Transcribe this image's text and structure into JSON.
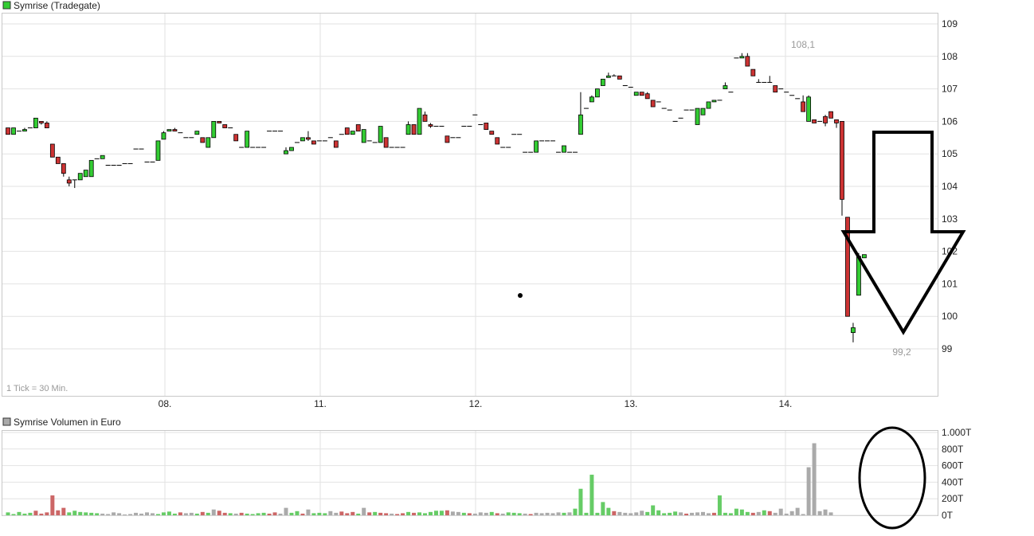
{
  "chart_data": [
    {
      "type": "candlestick",
      "title": "Symrise (Tradegate)",
      "note": "1 Tick = 30 Min.",
      "ylim": [
        98,
        109.5
      ],
      "yticks": [
        99,
        100,
        101,
        102,
        103,
        104,
        105,
        106,
        107,
        108,
        109
      ],
      "xticks": [
        "08.",
        "11.",
        "12.",
        "13.",
        "14."
      ],
      "annotations": {
        "high_label": "108,1",
        "low_label": "99,2"
      },
      "colors": {
        "up": "#33cc33",
        "down": "#cc3333",
        "neutral": "#999999"
      },
      "candles": [
        [
          105.8,
          105.6,
          105.8,
          105.6
        ],
        [
          105.6,
          105.8,
          105.8,
          105.6
        ],
        [
          105.7,
          105.7,
          105.7,
          105.7
        ],
        [
          105.7,
          105.75,
          105.8,
          105.7
        ],
        [
          105.8,
          105.8,
          105.8,
          105.8
        ],
        [
          105.8,
          106.1,
          106.1,
          105.8
        ],
        [
          106.0,
          105.95,
          106.0,
          105.9
        ],
        [
          105.95,
          105.8,
          106.0,
          105.8
        ],
        [
          105.3,
          104.9,
          105.3,
          104.9
        ],
        [
          104.9,
          104.7,
          104.9,
          104.7
        ],
        [
          104.7,
          104.4,
          104.7,
          104.3
        ],
        [
          104.2,
          104.1,
          104.3,
          104.0
        ],
        [
          104.2,
          104.2,
          104.2,
          103.95
        ],
        [
          104.2,
          104.4,
          104.4,
          104.2
        ],
        [
          104.3,
          104.5,
          104.5,
          104.3
        ],
        [
          104.3,
          104.8,
          104.8,
          104.3
        ],
        [
          104.85,
          104.85,
          104.85,
          104.85
        ],
        [
          104.85,
          104.95,
          104.95,
          104.85
        ],
        [
          104.65,
          104.65,
          104.65,
          104.65
        ],
        [
          104.65,
          104.65,
          104.65,
          104.65
        ],
        [
          104.65,
          104.65,
          104.65,
          104.65
        ],
        [
          104.7,
          104.7,
          104.7,
          104.7
        ],
        [
          104.7,
          104.7,
          104.7,
          104.7
        ],
        [
          105.15,
          105.15,
          105.15,
          105.15
        ],
        [
          105.15,
          105.15,
          105.15,
          105.15
        ],
        [
          104.75,
          104.75,
          104.75,
          104.75
        ],
        [
          104.75,
          104.75,
          104.75,
          104.75
        ],
        [
          104.8,
          105.4,
          105.4,
          104.8
        ],
        [
          105.45,
          105.65,
          105.7,
          105.45
        ],
        [
          105.7,
          105.75,
          105.75,
          105.7
        ],
        [
          105.75,
          105.7,
          105.8,
          105.7
        ],
        [
          105.65,
          105.65,
          105.65,
          105.65
        ],
        [
          105.5,
          105.5,
          105.5,
          105.5
        ],
        [
          105.5,
          105.5,
          105.5,
          105.5
        ],
        [
          105.6,
          105.7,
          105.7,
          105.6
        ],
        [
          105.5,
          105.35,
          105.5,
          105.35
        ],
        [
          105.2,
          105.5,
          105.5,
          105.2
        ],
        [
          105.5,
          106.0,
          106.0,
          105.5
        ],
        [
          106.0,
          105.95,
          106.0,
          105.95
        ],
        [
          105.9,
          105.8,
          105.9,
          105.8
        ],
        [
          105.8,
          105.8,
          105.8,
          105.8
        ],
        [
          105.6,
          105.4,
          105.6,
          105.4
        ],
        [
          105.2,
          105.2,
          105.2,
          105.2
        ],
        [
          105.2,
          105.7,
          105.7,
          105.2
        ],
        [
          105.2,
          105.2,
          105.2,
          105.2
        ],
        [
          105.2,
          105.2,
          105.2,
          105.2
        ],
        [
          105.2,
          105.2,
          105.2,
          105.2
        ],
        [
          105.7,
          105.7,
          105.7,
          105.7
        ],
        [
          105.7,
          105.7,
          105.7,
          105.7
        ],
        [
          105.7,
          105.7,
          105.7,
          105.7
        ],
        [
          105.0,
          105.1,
          105.2,
          105.0
        ],
        [
          105.1,
          105.2,
          105.2,
          105.1
        ],
        [
          105.35,
          105.35,
          105.35,
          105.35
        ],
        [
          105.4,
          105.5,
          105.5,
          105.4
        ],
        [
          105.5,
          105.45,
          105.7,
          105.4
        ],
        [
          105.4,
          105.3,
          105.4,
          105.3
        ],
        [
          105.4,
          105.4,
          105.4,
          105.4
        ],
        [
          105.4,
          105.4,
          105.4,
          105.4
        ],
        [
          105.5,
          105.5,
          105.5,
          105.5
        ],
        [
          105.4,
          105.2,
          105.4,
          105.2
        ],
        [
          105.6,
          105.6,
          105.6,
          105.6
        ],
        [
          105.8,
          105.6,
          105.8,
          105.6
        ],
        [
          105.6,
          105.7,
          105.7,
          105.6
        ],
        [
          105.9,
          105.7,
          105.9,
          105.7
        ],
        [
          105.35,
          105.75,
          105.75,
          105.35
        ],
        [
          105.4,
          105.4,
          105.4,
          105.4
        ],
        [
          105.35,
          105.35,
          105.35,
          105.35
        ],
        [
          105.35,
          105.85,
          105.85,
          105.35
        ],
        [
          105.5,
          105.2,
          105.5,
          105.2
        ],
        [
          105.2,
          105.2,
          105.2,
          105.2
        ],
        [
          105.2,
          105.2,
          105.2,
          105.2
        ],
        [
          105.2,
          105.2,
          105.2,
          105.2
        ],
        [
          105.6,
          105.9,
          106.0,
          105.6
        ],
        [
          105.9,
          105.6,
          105.9,
          105.6
        ],
        [
          105.6,
          106.4,
          106.4,
          105.6
        ],
        [
          106.2,
          106.0,
          106.3,
          106.0
        ],
        [
          105.9,
          105.85,
          105.95,
          105.8
        ],
        [
          105.85,
          105.85,
          105.85,
          105.85
        ],
        [
          105.85,
          105.85,
          105.85,
          105.85
        ],
        [
          105.55,
          105.35,
          105.55,
          105.35
        ],
        [
          105.5,
          105.5,
          105.5,
          105.5
        ],
        [
          105.5,
          105.5,
          105.5,
          105.5
        ],
        [
          105.85,
          105.85,
          105.85,
          105.85
        ],
        [
          105.85,
          105.85,
          105.85,
          105.85
        ],
        [
          106.2,
          106.2,
          106.2,
          106.2
        ],
        [
          105.9,
          105.9,
          105.9,
          105.9
        ],
        [
          105.95,
          105.75,
          105.95,
          105.75
        ],
        [
          105.7,
          105.6,
          105.7,
          105.6
        ],
        [
          105.5,
          105.3,
          105.5,
          105.3
        ],
        [
          105.2,
          105.2,
          105.2,
          105.2
        ],
        [
          105.2,
          105.2,
          105.2,
          105.2
        ],
        [
          105.6,
          105.6,
          105.6,
          105.6
        ],
        [
          105.6,
          105.6,
          105.6,
          105.6
        ],
        [
          105.05,
          105.05,
          105.05,
          105.05
        ],
        [
          105.05,
          105.05,
          105.05,
          105.05
        ],
        [
          105.05,
          105.4,
          105.4,
          105.05
        ],
        [
          105.4,
          105.4,
          105.4,
          105.4
        ],
        [
          105.4,
          105.4,
          105.4,
          105.4
        ],
        [
          105.4,
          105.4,
          105.4,
          105.4
        ],
        [
          105.05,
          105.05,
          105.05,
          105.05
        ],
        [
          105.05,
          105.25,
          105.25,
          105.05
        ],
        [
          105.05,
          105.05,
          105.05,
          105.05
        ],
        [
          105.05,
          105.05,
          105.05,
          105.05
        ],
        [
          105.6,
          106.2,
          106.9,
          105.6
        ],
        [
          106.4,
          106.4,
          106.4,
          106.4
        ],
        [
          106.6,
          106.75,
          106.8,
          106.6
        ],
        [
          106.75,
          107.0,
          107.0,
          106.75
        ],
        [
          107.1,
          107.3,
          107.3,
          107.1
        ],
        [
          107.35,
          107.4,
          107.5,
          107.35
        ],
        [
          107.4,
          107.4,
          107.45,
          107.4
        ],
        [
          107.4,
          107.3,
          107.4,
          107.3
        ],
        [
          107.1,
          107.1,
          107.1,
          107.1
        ],
        [
          107.05,
          107.05,
          107.05,
          107.05
        ],
        [
          106.8,
          106.9,
          106.9,
          106.8
        ],
        [
          106.9,
          106.8,
          106.9,
          106.8
        ],
        [
          106.85,
          106.7,
          106.9,
          106.7
        ],
        [
          106.65,
          106.45,
          106.65,
          106.45
        ],
        [
          106.6,
          106.6,
          106.6,
          106.6
        ],
        [
          106.4,
          106.4,
          106.4,
          106.4
        ],
        [
          106.35,
          106.35,
          106.35,
          106.35
        ],
        [
          106.0,
          106.0,
          106.0,
          106.0
        ],
        [
          106.1,
          106.1,
          106.1,
          106.1
        ],
        [
          106.35,
          106.35,
          106.35,
          106.35
        ],
        [
          106.35,
          106.35,
          106.35,
          106.35
        ],
        [
          105.9,
          106.4,
          106.4,
          105.9
        ],
        [
          106.2,
          106.4,
          106.4,
          106.2
        ],
        [
          106.4,
          106.6,
          106.6,
          106.4
        ],
        [
          106.6,
          106.65,
          106.65,
          106.6
        ],
        [
          106.65,
          106.65,
          106.65,
          106.65
        ],
        [
          107.0,
          107.1,
          107.2,
          107.0
        ],
        [
          106.9,
          106.9,
          106.9,
          106.9
        ],
        [
          107.95,
          107.95,
          107.95,
          107.95
        ],
        [
          107.95,
          108.0,
          108.1,
          107.95
        ],
        [
          108.0,
          107.7,
          108.1,
          107.7
        ],
        [
          107.6,
          107.4,
          107.6,
          107.4
        ],
        [
          107.2,
          107.2,
          107.3,
          107.2
        ],
        [
          107.2,
          107.2,
          107.2,
          107.2
        ],
        [
          107.2,
          107.2,
          107.4,
          107.2
        ],
        [
          107.1,
          106.9,
          107.1,
          106.9
        ],
        [
          107.0,
          107.0,
          107.0,
          107.0
        ],
        [
          106.9,
          106.9,
          106.9,
          106.9
        ],
        [
          106.8,
          106.8,
          106.8,
          106.8
        ],
        [
          106.7,
          106.7,
          106.7,
          106.7
        ],
        [
          106.6,
          106.3,
          106.8,
          106.3
        ],
        [
          106.0,
          106.75,
          106.8,
          106.0
        ],
        [
          106.05,
          105.95,
          106.05,
          105.95
        ],
        [
          106.0,
          106.0,
          106.0,
          106.0
        ],
        [
          106.15,
          105.95,
          106.2,
          105.85
        ],
        [
          106.3,
          106.1,
          106.3,
          106.1
        ],
        [
          106.05,
          105.95,
          106.05,
          105.8
        ],
        [
          106.0,
          103.6,
          106.0,
          103.1
        ],
        [
          103.05,
          100.0,
          103.05,
          100.0
        ],
        [
          99.5,
          99.65,
          99.8,
          99.2
        ],
        [
          100.65,
          101.85,
          101.95,
          100.65
        ],
        [
          101.8,
          101.9,
          101.9,
          101.8
        ]
      ]
    },
    {
      "type": "bar",
      "title": "Symrise Volumen in Euro",
      "ylim": [
        0,
        1000
      ],
      "yticks": [
        "0T",
        "200T",
        "400T",
        "600T",
        "800T",
        "1.000T"
      ],
      "values": [
        35,
        15,
        40,
        20,
        30,
        55,
        20,
        35,
        240,
        60,
        90,
        35,
        55,
        40,
        35,
        30,
        25,
        20,
        15,
        35,
        25,
        10,
        15,
        30,
        20,
        35,
        25,
        15,
        35,
        45,
        20,
        35,
        25,
        30,
        20,
        40,
        30,
        70,
        55,
        30,
        25,
        20,
        30,
        20,
        15,
        25,
        30,
        20,
        35,
        20,
        90,
        30,
        50,
        20,
        70,
        25,
        30,
        25,
        50,
        30,
        45,
        25,
        40,
        20,
        90,
        35,
        40,
        30,
        25,
        20,
        15,
        25,
        40,
        30,
        35,
        25,
        40,
        55,
        55,
        60,
        45,
        40,
        30,
        25,
        20,
        35,
        30,
        40,
        25,
        20,
        35,
        30,
        25,
        20,
        15,
        30,
        25,
        30,
        25,
        35,
        30,
        35,
        80,
        320,
        30,
        490,
        30,
        160,
        90,
        50,
        40,
        30,
        25,
        35,
        55,
        40,
        120,
        60,
        25,
        30,
        45,
        35,
        20,
        30,
        35,
        40,
        25,
        30,
        240,
        30,
        25,
        80,
        70,
        40,
        30,
        40,
        60,
        50,
        30,
        80,
        20,
        50,
        90,
        15,
        580,
        870,
        50,
        70,
        35
      ],
      "directions": "uuuuudddddduuuuuunnnnnnnnnnuuuudnnudunddunduuuuddnnuudnuuunndddunduddndduduuuuudnnudnnnudnuuundnnnnnunuuuuuuudnnnnnuuuuuundnnnnduuuuuudnudnnnnnnnnnnnnnnnnnnnnnnnnnnddnndududuu",
      "colors": {
        "up": "#66cc66",
        "down": "#cc6666",
        "neutral": "#aaaaaa"
      }
    }
  ]
}
